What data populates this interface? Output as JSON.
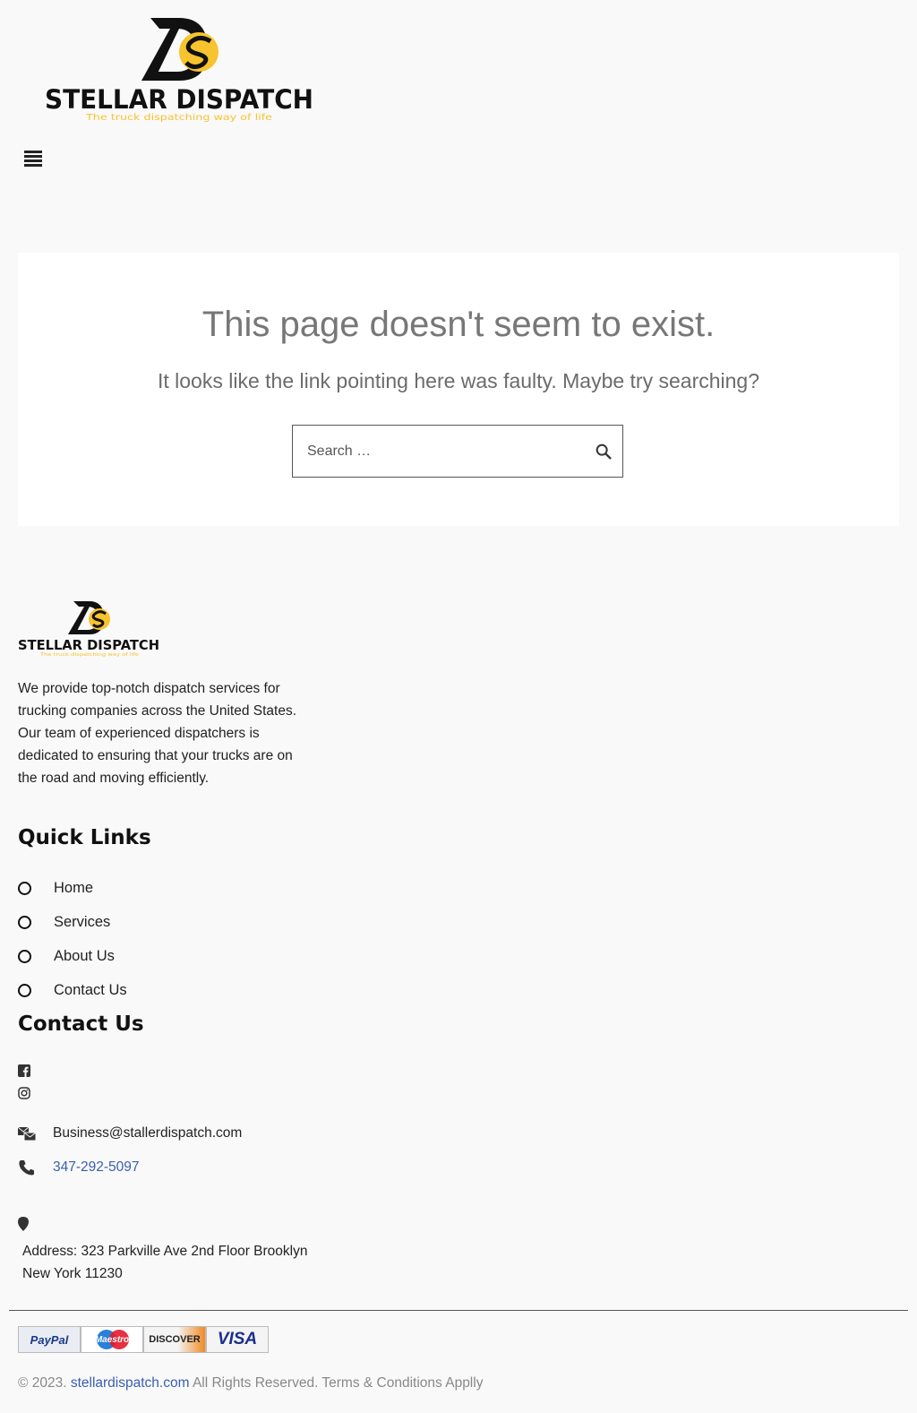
{
  "header": {
    "logo": {
      "name": "STELLAR DISPATCH",
      "tagline": "The truck dispatching way of life",
      "monogram": "DS"
    },
    "menu_icon": "hamburger-menu-icon"
  },
  "error": {
    "title": "This page doesn't seem to exist.",
    "message": "It looks like the link pointing here was faulty. Maybe try searching?",
    "search_placeholder": "Search …",
    "search_icon": "search-icon"
  },
  "footer": {
    "logo": {
      "name": "STELLAR DISPATCH",
      "tagline": "The truck dispatching way of life",
      "monogram": "DS"
    },
    "about": "We provide top-notch dispatch services for trucking companies across the United States. Our team of experienced dispatchers is dedicated to ensuring that your trucks are on the road and moving efficiently.",
    "quick_links_title": "Quick Links",
    "quick_links": [
      {
        "label": "Home"
      },
      {
        "label": "Services"
      },
      {
        "label": "About Us"
      },
      {
        "label": "Contact Us"
      }
    ],
    "contact_title": "Contact Us",
    "social": [
      {
        "icon": "facebook-icon"
      },
      {
        "icon": "instagram-icon"
      }
    ],
    "email": "Business@stallerdispatch.com",
    "phone": "347-292-5097",
    "address_line1": "Address: 323 Parkville Ave 2nd Floor Brooklyn",
    "address_line2": "New York 11230",
    "payment_cards": [
      "PayPal",
      "Maestro",
      "DISCOVER",
      "VISA"
    ],
    "copyright_prefix": "© 2023.",
    "copyright_link": "stellardispatch.com",
    "copyright_suffix": "All Rights Reserved. Terms & Conditions Applly"
  },
  "colors": {
    "brand_yellow": "#f7c32e",
    "brand_black": "#111111",
    "link_blue": "#3a5eb0",
    "background": "#f9f9f9"
  }
}
